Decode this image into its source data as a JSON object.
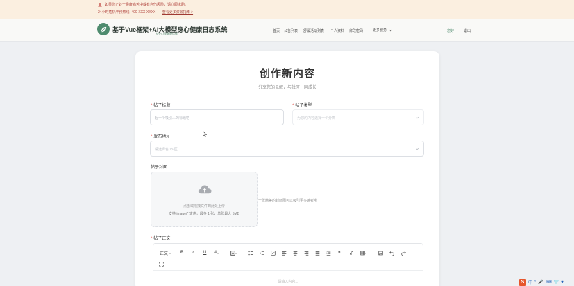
{
  "alert": {
    "line1": "如果您正处于极度痛苦中或有自伤风险，请立即求助。",
    "hotline": "24小时危机干预热线: 400-XXX-XXXX",
    "resources_link": "查看更多资源指南 >"
  },
  "header": {
    "title": "基于Vue框架+AI大模型身心健康日志系统",
    "subtitle": "专业心理健康伙伴",
    "nav": [
      "首页",
      "公告列表",
      "舒缓活动列表",
      "个人资料",
      "修改密码"
    ],
    "more_label": "更多服务",
    "greeting": "您好",
    "logout": "退出"
  },
  "page": {
    "title": "创作新内容",
    "subtitle": "分享您的见解，与社区一同成长"
  },
  "form": {
    "post_title": {
      "label": "帖子标题",
      "placeholder": "起一个吸引人的标题吧"
    },
    "post_type": {
      "label": "帖子类型",
      "placeholder": "为您的内容选择一个分类"
    },
    "location": {
      "label": "发布地址",
      "placeholder": "请选择省/市/区"
    },
    "cover": {
      "label": "帖子封面",
      "upload_main": "点击或拖拽文件到此处上传",
      "upload_tip": "支持 image/* 文件，最多 1 张，单张最大 5MB",
      "side_hint": "一张精美的封面图可以吸引更多读者哦"
    },
    "body": {
      "label": "帖子正文",
      "toolbar_text": "正文",
      "placeholder": "请输入内容..."
    }
  },
  "tray": {
    "items": [
      "中",
      "°",
      "🎤",
      "⌨",
      "👕",
      "♥"
    ]
  },
  "colors": {
    "accent": "#4e8b6e",
    "alert_bg": "#fbefe0",
    "alert_text": "#b0413a"
  }
}
